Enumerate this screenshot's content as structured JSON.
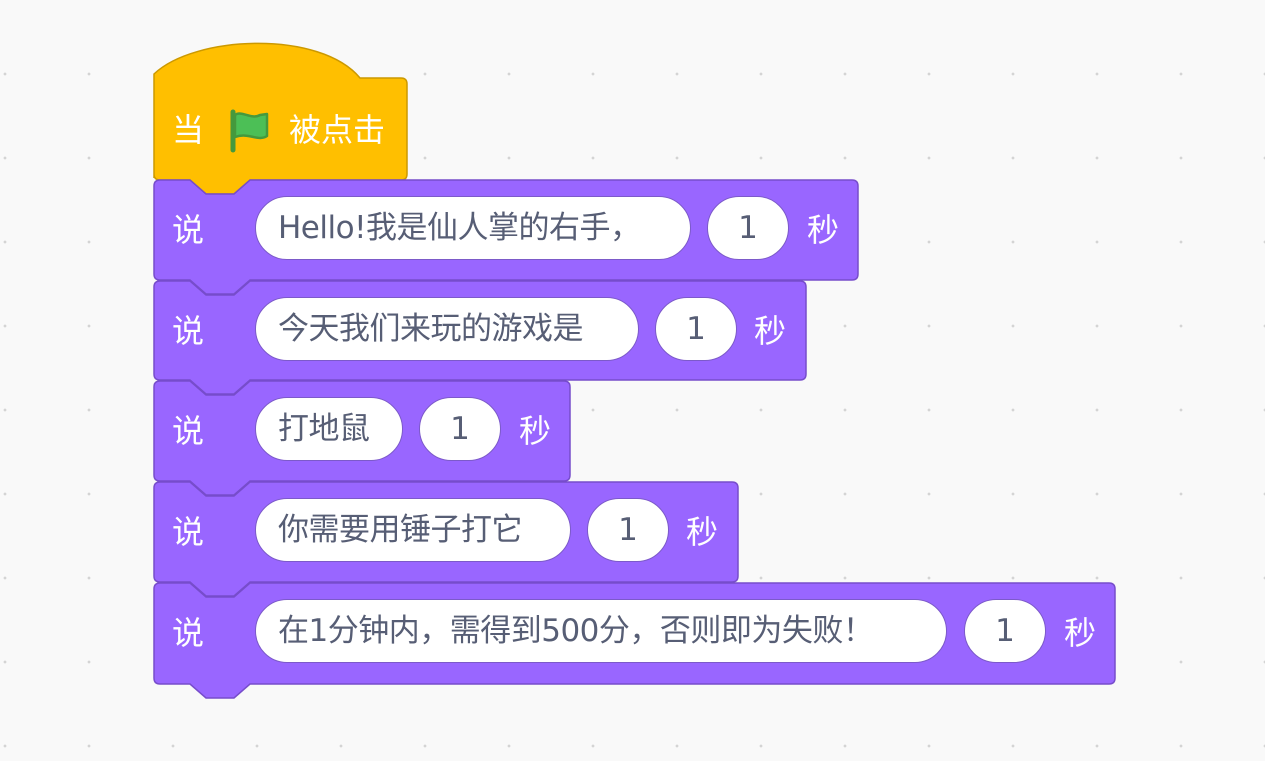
{
  "hat_block": {
    "when_label": "当",
    "flag_icon": "green-flag-icon",
    "clicked_label": "被点击",
    "color": "#ffbf00"
  },
  "say_blocks": [
    {
      "say_label": "说",
      "message": "Hello!我是仙人掌的右手，",
      "seconds": "1",
      "unit_label": "秒"
    },
    {
      "say_label": "说",
      "message": "今天我们来玩的游戏是",
      "seconds": "1",
      "unit_label": "秒"
    },
    {
      "say_label": "说",
      "message": "打地鼠",
      "seconds": "1",
      "unit_label": "秒"
    },
    {
      "say_label": "说",
      "message": "你需要用锤子打它",
      "seconds": "1",
      "unit_label": "秒"
    },
    {
      "say_label": "说",
      "message": "在1分钟内，需得到500分，否则即为失败！",
      "seconds": "1",
      "unit_label": "秒"
    }
  ],
  "colors": {
    "looks_block": "#9966ff",
    "looks_border": "#774dcb",
    "events_block": "#ffbf00",
    "events_border": "#cc9900",
    "field_text": "#575e75",
    "workspace": "#f9f9f9"
  }
}
